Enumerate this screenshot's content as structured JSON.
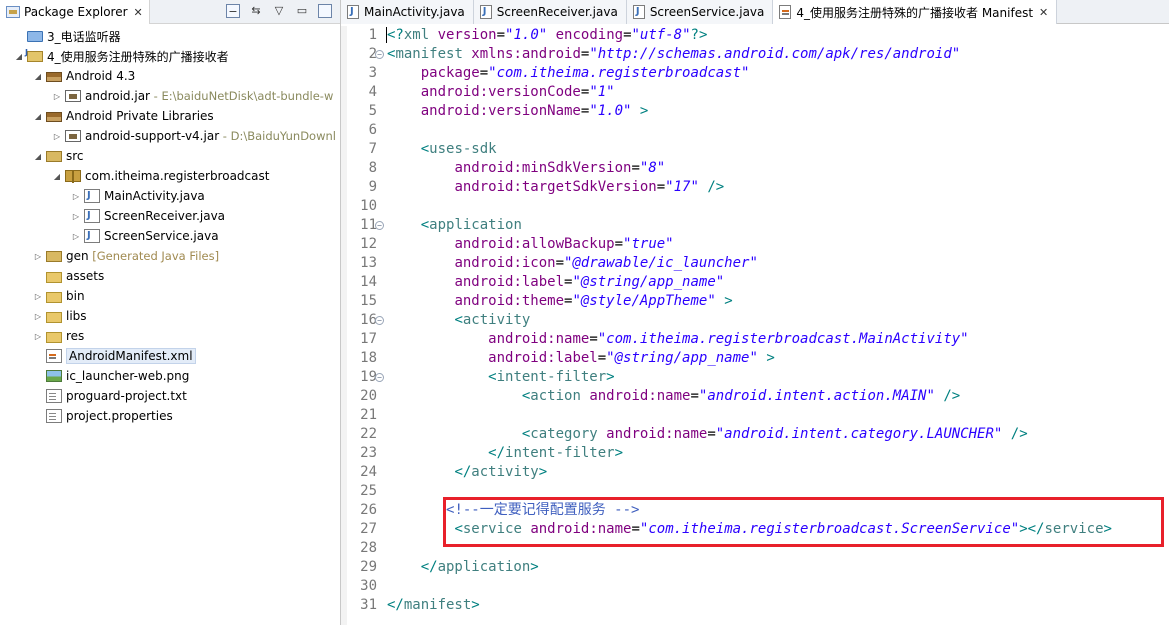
{
  "package_explorer": {
    "tab_title": "Package Explorer",
    "tree": [
      {
        "name": "3_电话监听器",
        "icon": "workspace-icon",
        "depth": 0,
        "twisty": "none"
      },
      {
        "name": "4_使用服务注册特殊的广播接收者",
        "icon": "android-project-icon",
        "depth": 0,
        "twisty": "expanded"
      },
      {
        "name": "Android 4.3",
        "icon": "library-icon",
        "depth": 1,
        "twisty": "expanded"
      },
      {
        "name": "android.jar",
        "suffix": " - E:\\baiduNetDisk\\adt-bundle-w",
        "icon": "jar-icon",
        "depth": 2,
        "twisty": "collapsed"
      },
      {
        "name": "Android Private Libraries",
        "icon": "library-icon",
        "depth": 1,
        "twisty": "expanded"
      },
      {
        "name": "android-support-v4.jar",
        "suffix": " - D:\\BaiduYunDownl",
        "icon": "jar-icon",
        "depth": 2,
        "twisty": "collapsed"
      },
      {
        "name": "src",
        "icon": "source-folder-icon",
        "depth": 1,
        "twisty": "expanded"
      },
      {
        "name": "com.itheima.registerbroadcast",
        "icon": "package-icon",
        "depth": 2,
        "twisty": "expanded"
      },
      {
        "name": "MainActivity.java",
        "icon": "java-file-icon",
        "depth": 3,
        "twisty": "collapsed"
      },
      {
        "name": "ScreenReceiver.java",
        "icon": "java-file-icon",
        "depth": 3,
        "twisty": "collapsed"
      },
      {
        "name": "ScreenService.java",
        "icon": "java-file-icon",
        "depth": 3,
        "twisty": "collapsed"
      },
      {
        "name": "gen",
        "suffix": " [Generated Java Files]",
        "icon": "source-folder-icon",
        "depth": 1,
        "twisty": "collapsed"
      },
      {
        "name": "assets",
        "icon": "folder-icon",
        "depth": 1,
        "twisty": "none"
      },
      {
        "name": "bin",
        "icon": "folder-icon",
        "depth": 1,
        "twisty": "collapsed"
      },
      {
        "name": "libs",
        "icon": "folder-icon",
        "depth": 1,
        "twisty": "collapsed"
      },
      {
        "name": "res",
        "icon": "folder-icon",
        "depth": 1,
        "twisty": "collapsed"
      },
      {
        "name": "AndroidManifest.xml",
        "icon": "xml-file-icon",
        "depth": 1,
        "twisty": "none",
        "selected": true
      },
      {
        "name": "ic_launcher-web.png",
        "icon": "image-file-icon",
        "depth": 1,
        "twisty": "none"
      },
      {
        "name": "proguard-project.txt",
        "icon": "text-file-icon",
        "depth": 1,
        "twisty": "none"
      },
      {
        "name": "project.properties",
        "icon": "text-file-icon",
        "depth": 1,
        "twisty": "none"
      }
    ]
  },
  "editor": {
    "tabs": [
      {
        "label": "MainActivity.java",
        "icon": "java-file-icon",
        "active": false
      },
      {
        "label": "ScreenReceiver.java",
        "icon": "java-file-icon",
        "active": false
      },
      {
        "label": "ScreenService.java",
        "icon": "java-file-icon",
        "active": false
      },
      {
        "label": "4_使用服务注册特殊的广播接收者 Manifest",
        "icon": "manifest-file-icon",
        "active": true
      }
    ],
    "lines": [
      {
        "n": "1",
        "fold": "",
        "segs": [
          [
            "pun",
            "<?"
          ],
          [
            "tag",
            "xml "
          ],
          [
            "attr",
            "version"
          ],
          [
            "txt-plain",
            "="
          ],
          [
            "val",
            "\"1.0\""
          ],
          [
            "txt-plain",
            " "
          ],
          [
            "attr",
            "encoding"
          ],
          [
            "txt-plain",
            "="
          ],
          [
            "val",
            "\"utf-8\""
          ],
          [
            "pun",
            "?>"
          ]
        ]
      },
      {
        "n": "2",
        "fold": "⊖",
        "segs": [
          [
            "pun",
            "<"
          ],
          [
            "tag",
            "manifest "
          ],
          [
            "attr",
            "xmlns:android"
          ],
          [
            "txt-plain",
            "="
          ],
          [
            "val",
            "\"http://schemas.android.com/apk/res/android\""
          ]
        ]
      },
      {
        "n": "3",
        "fold": "",
        "segs": [
          [
            "txt-plain",
            "    "
          ],
          [
            "attr",
            "package"
          ],
          [
            "txt-plain",
            "="
          ],
          [
            "val",
            "\"com.itheima.registerbroadcast\""
          ]
        ]
      },
      {
        "n": "4",
        "fold": "",
        "segs": [
          [
            "txt-plain",
            "    "
          ],
          [
            "attr",
            "android:versionCode"
          ],
          [
            "txt-plain",
            "="
          ],
          [
            "val",
            "\"1\""
          ]
        ]
      },
      {
        "n": "5",
        "fold": "",
        "segs": [
          [
            "txt-plain",
            "    "
          ],
          [
            "attr",
            "android:versionName"
          ],
          [
            "txt-plain",
            "="
          ],
          [
            "val",
            "\"1.0\""
          ],
          [
            "txt-plain",
            " "
          ],
          [
            "pun",
            ">"
          ]
        ]
      },
      {
        "n": "6",
        "fold": "",
        "segs": []
      },
      {
        "n": "7",
        "fold": "",
        "segs": [
          [
            "txt-plain",
            "    "
          ],
          [
            "pun",
            "<"
          ],
          [
            "tag",
            "uses-sdk"
          ]
        ]
      },
      {
        "n": "8",
        "fold": "",
        "segs": [
          [
            "txt-plain",
            "        "
          ],
          [
            "attr",
            "android:minSdkVersion"
          ],
          [
            "txt-plain",
            "="
          ],
          [
            "val",
            "\"8\""
          ]
        ]
      },
      {
        "n": "9",
        "fold": "",
        "segs": [
          [
            "txt-plain",
            "        "
          ],
          [
            "attr",
            "android:targetSdkVersion"
          ],
          [
            "txt-plain",
            "="
          ],
          [
            "val",
            "\"17\""
          ],
          [
            "txt-plain",
            " "
          ],
          [
            "pun",
            "/>"
          ]
        ]
      },
      {
        "n": "10",
        "fold": "",
        "segs": []
      },
      {
        "n": "11",
        "fold": "⊖",
        "segs": [
          [
            "txt-plain",
            "    "
          ],
          [
            "pun",
            "<"
          ],
          [
            "tag",
            "application"
          ]
        ]
      },
      {
        "n": "12",
        "fold": "",
        "segs": [
          [
            "txt-plain",
            "        "
          ],
          [
            "attr",
            "android:allowBackup"
          ],
          [
            "txt-plain",
            "="
          ],
          [
            "val",
            "\"true\""
          ]
        ]
      },
      {
        "n": "13",
        "fold": "",
        "segs": [
          [
            "txt-plain",
            "        "
          ],
          [
            "attr",
            "android:icon"
          ],
          [
            "txt-plain",
            "="
          ],
          [
            "val",
            "\"@drawable/ic_launcher\""
          ]
        ]
      },
      {
        "n": "14",
        "fold": "",
        "segs": [
          [
            "txt-plain",
            "        "
          ],
          [
            "attr",
            "android:label"
          ],
          [
            "txt-plain",
            "="
          ],
          [
            "val",
            "\"@string/app_name\""
          ]
        ]
      },
      {
        "n": "15",
        "fold": "",
        "segs": [
          [
            "txt-plain",
            "        "
          ],
          [
            "attr",
            "android:theme"
          ],
          [
            "txt-plain",
            "="
          ],
          [
            "val",
            "\"@style/AppTheme\""
          ],
          [
            "txt-plain",
            " "
          ],
          [
            "pun",
            ">"
          ]
        ]
      },
      {
        "n": "16",
        "fold": "⊖",
        "segs": [
          [
            "txt-plain",
            "        "
          ],
          [
            "pun",
            "<"
          ],
          [
            "tag",
            "activity"
          ]
        ]
      },
      {
        "n": "17",
        "fold": "",
        "segs": [
          [
            "txt-plain",
            "            "
          ],
          [
            "attr",
            "android:name"
          ],
          [
            "txt-plain",
            "="
          ],
          [
            "val",
            "\"com.itheima.registerbroadcast.MainActivity\""
          ]
        ]
      },
      {
        "n": "18",
        "fold": "",
        "segs": [
          [
            "txt-plain",
            "            "
          ],
          [
            "attr",
            "android:label"
          ],
          [
            "txt-plain",
            "="
          ],
          [
            "val",
            "\"@string/app_name\""
          ],
          [
            "txt-plain",
            " "
          ],
          [
            "pun",
            ">"
          ]
        ]
      },
      {
        "n": "19",
        "fold": "⊖",
        "segs": [
          [
            "txt-plain",
            "            "
          ],
          [
            "pun",
            "<"
          ],
          [
            "tag",
            "intent-filter"
          ],
          [
            "pun",
            ">"
          ]
        ]
      },
      {
        "n": "20",
        "fold": "",
        "segs": [
          [
            "txt-plain",
            "                "
          ],
          [
            "pun",
            "<"
          ],
          [
            "tag",
            "action "
          ],
          [
            "attr",
            "android:name"
          ],
          [
            "txt-plain",
            "="
          ],
          [
            "val",
            "\"android.intent.action.MAIN\""
          ],
          [
            "txt-plain",
            " "
          ],
          [
            "pun",
            "/>"
          ]
        ]
      },
      {
        "n": "21",
        "fold": "",
        "segs": []
      },
      {
        "n": "22",
        "fold": "",
        "segs": [
          [
            "txt-plain",
            "                "
          ],
          [
            "pun",
            "<"
          ],
          [
            "tag",
            "category "
          ],
          [
            "attr",
            "android:name"
          ],
          [
            "txt-plain",
            "="
          ],
          [
            "val",
            "\"android.intent.category.LAUNCHER\""
          ],
          [
            "txt-plain",
            " "
          ],
          [
            "pun",
            "/>"
          ]
        ]
      },
      {
        "n": "23",
        "fold": "",
        "segs": [
          [
            "txt-plain",
            "            "
          ],
          [
            "pun",
            "</"
          ],
          [
            "tag",
            "intent-filter"
          ],
          [
            "pun",
            ">"
          ]
        ]
      },
      {
        "n": "24",
        "fold": "",
        "segs": [
          [
            "txt-plain",
            "        "
          ],
          [
            "pun",
            "</"
          ],
          [
            "tag",
            "activity"
          ],
          [
            "pun",
            ">"
          ]
        ]
      },
      {
        "n": "25",
        "fold": "",
        "segs": []
      },
      {
        "n": "26",
        "fold": "",
        "segs": [
          [
            "txt-plain",
            "       "
          ],
          [
            "cmt",
            "<!--一定要记得配置服务 -->"
          ]
        ]
      },
      {
        "n": "27",
        "fold": "",
        "segs": [
          [
            "txt-plain",
            "        "
          ],
          [
            "pun",
            "<"
          ],
          [
            "tag",
            "service "
          ],
          [
            "attr",
            "android:name"
          ],
          [
            "txt-plain",
            "="
          ],
          [
            "val",
            "\"com.itheima.registerbroadcast.ScreenService\""
          ],
          [
            "pun",
            "></"
          ],
          [
            "tag",
            "service"
          ],
          [
            "pun",
            ">"
          ]
        ]
      },
      {
        "n": "28",
        "fold": "",
        "segs": []
      },
      {
        "n": "29",
        "fold": "",
        "segs": [
          [
            "txt-plain",
            "    "
          ],
          [
            "pun",
            "</"
          ],
          [
            "tag",
            "application"
          ],
          [
            "pun",
            ">"
          ]
        ]
      },
      {
        "n": "30",
        "fold": "",
        "segs": []
      },
      {
        "n": "31",
        "fold": "",
        "segs": [
          [
            "pun",
            "</"
          ],
          [
            "tag",
            "manifest"
          ],
          [
            "pun",
            ">"
          ]
        ]
      }
    ]
  },
  "colors": {
    "highlight_box": "#e8202a",
    "xml_tag": "#3f7f7f",
    "xml_attr": "#7f007f",
    "xml_value": "#2a00ff",
    "xml_comment": "#3f5fbf"
  }
}
